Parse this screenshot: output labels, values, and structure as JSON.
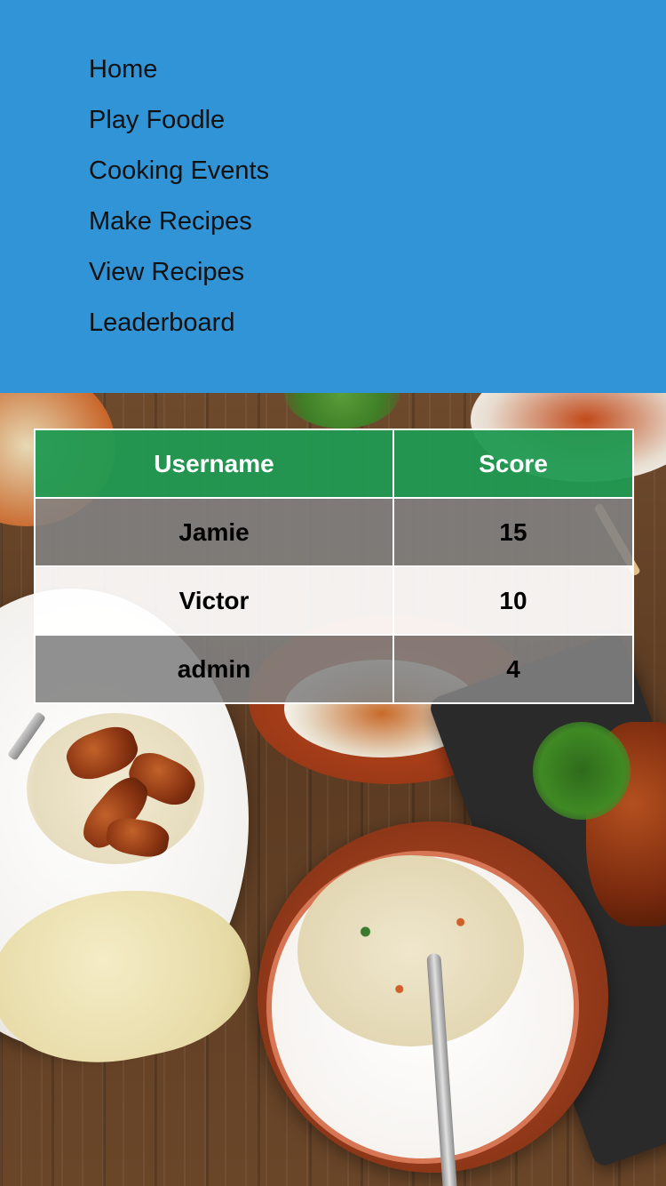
{
  "nav": {
    "items": [
      {
        "label": "Home"
      },
      {
        "label": "Play Foodle"
      },
      {
        "label": "Cooking Events"
      },
      {
        "label": "Make Recipes"
      },
      {
        "label": "View Recipes"
      },
      {
        "label": "Leaderboard"
      }
    ]
  },
  "colors": {
    "nav_background": "#3194d6",
    "table_header": "#209a52",
    "row_odd": "#828282",
    "row_even": "#ffffff"
  },
  "background_image": "food-table-photo",
  "leaderboard": {
    "headers": {
      "username": "Username",
      "score": "Score"
    },
    "rows": [
      {
        "username": "Jamie",
        "score": "15"
      },
      {
        "username": "Victor",
        "score": "10"
      },
      {
        "username": "admin",
        "score": "4"
      }
    ]
  }
}
